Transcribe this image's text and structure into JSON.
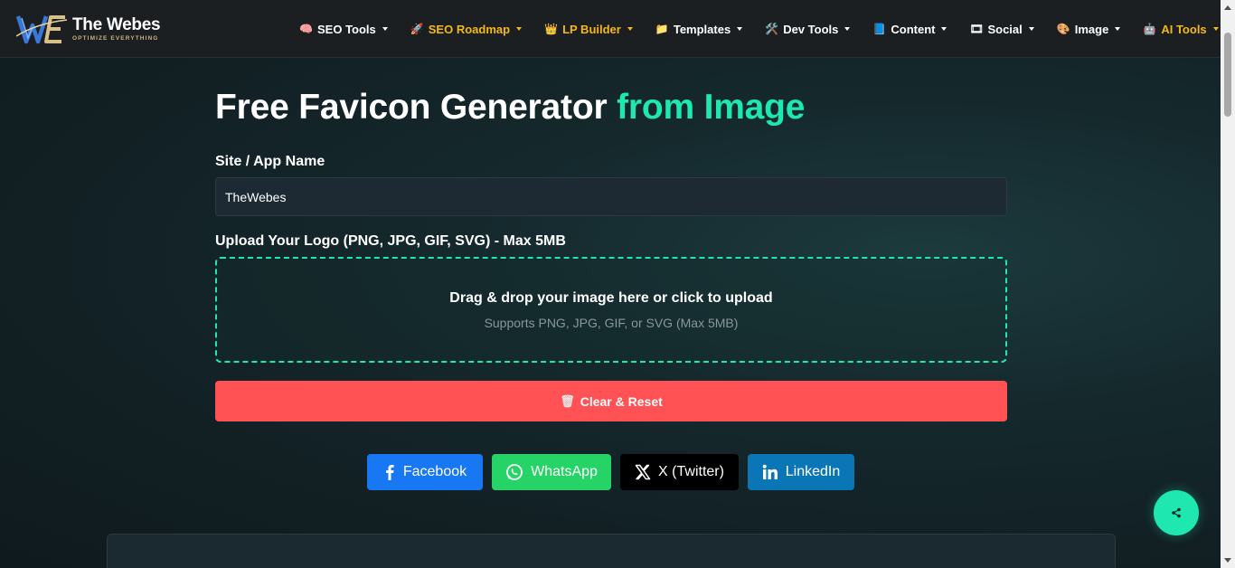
{
  "brand": {
    "name": "The Webes",
    "tagline": "OPTIMIZE EVERYTHING"
  },
  "nav": [
    {
      "icon": "🧠",
      "label": "SEO Tools",
      "gold": false
    },
    {
      "icon": "🚀",
      "label": "SEO Roadmap",
      "gold": true
    },
    {
      "icon": "👑",
      "label": "LP Builder",
      "gold": true
    },
    {
      "icon": "📁",
      "label": "Templates",
      "gold": false
    },
    {
      "icon": "🛠️",
      "label": "Dev Tools",
      "gold": false
    },
    {
      "icon": "📘",
      "label": "Content",
      "gold": false
    },
    {
      "icon": "🎞",
      "label": "Social",
      "gold": false
    },
    {
      "icon": "🎨",
      "label": "Image",
      "gold": false
    },
    {
      "icon": "🤖",
      "label": "AI Tools",
      "gold": true
    }
  ],
  "page": {
    "title_main": "Free Favicon Generator ",
    "title_accent": "from Image"
  },
  "form": {
    "site_label": "Site / App Name",
    "site_value": "TheWebes",
    "upload_label": "Upload Your Logo (PNG, JPG, GIF, SVG) - Max 5MB",
    "dropzone_main": "Drag & drop your image here or click to upload",
    "dropzone_sub": "Supports PNG, JPG, GIF, or SVG (Max 5MB)",
    "clear_icon": "🗑",
    "clear_label": "Clear & Reset"
  },
  "share": {
    "facebook": "Facebook",
    "whatsapp": "WhatsApp",
    "twitter": "X (Twitter)",
    "linkedin": "LinkedIn"
  },
  "colors": {
    "accent": "#1ee8b0",
    "gold": "#f5b818",
    "danger": "#ff5254",
    "facebook": "#1877f2",
    "whatsapp": "#25d366",
    "linkedin": "#0a76b6"
  }
}
